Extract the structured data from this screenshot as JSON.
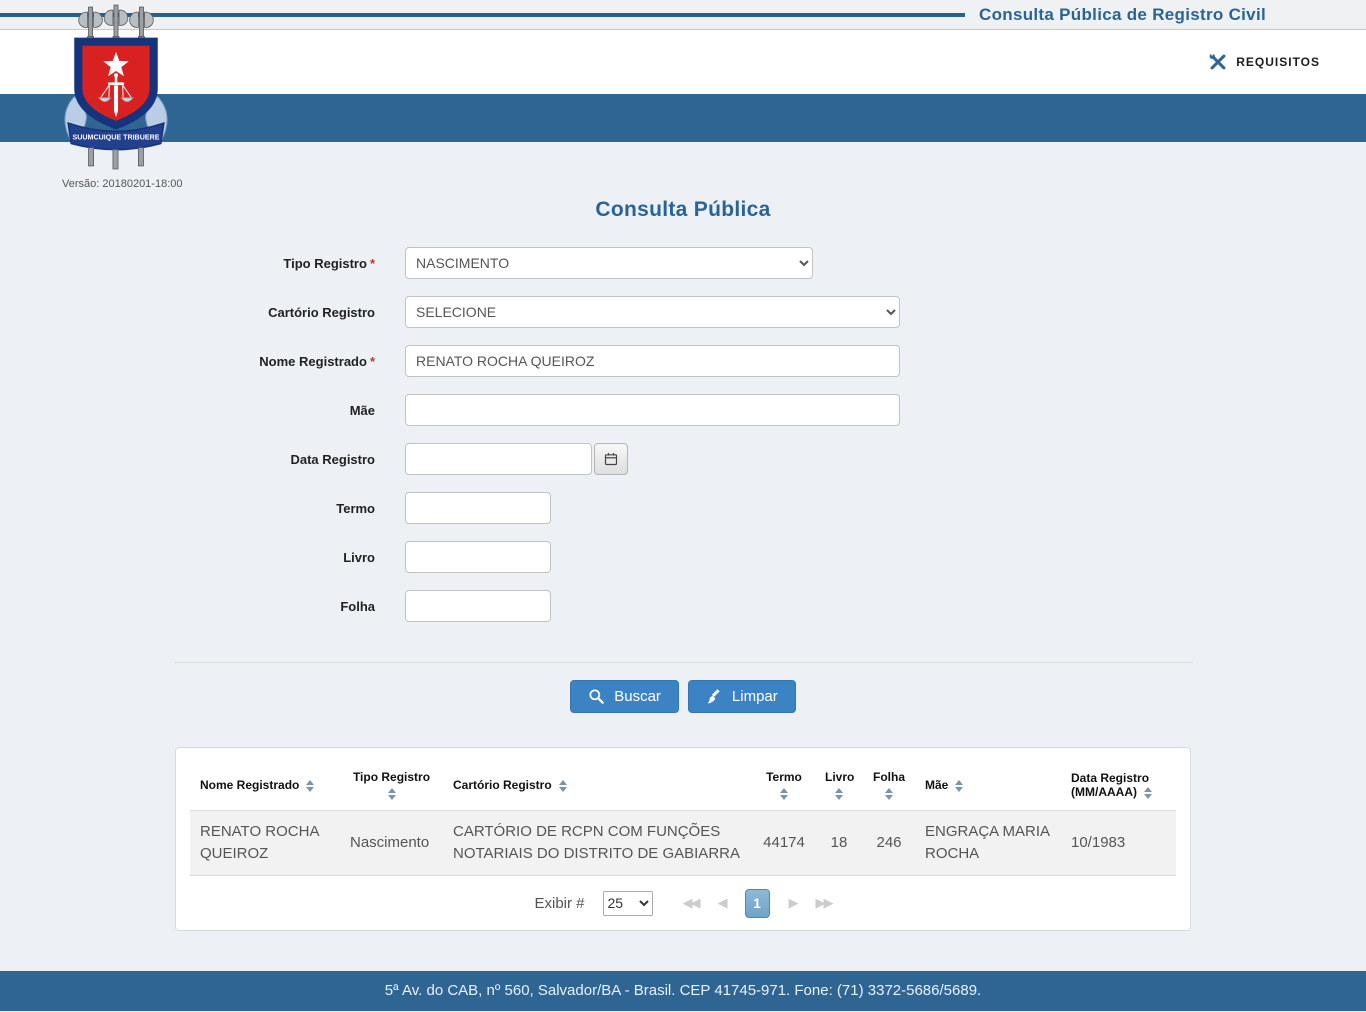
{
  "header": {
    "top_title": "Consulta Pública de Registro Civil",
    "requisitos_label": "REQUISITOS",
    "version": "Versão: 20180201-18:00",
    "logo_motto": "SUUMCUIQUE TRIBUERE"
  },
  "form": {
    "title": "Consulta Pública",
    "required_marker": "*",
    "tipo_registro": {
      "label": "Tipo Registro",
      "value": "NASCIMENTO"
    },
    "cartorio_registro": {
      "label": "Cartório Registro",
      "value": "SELECIONE"
    },
    "nome_registrado": {
      "label": "Nome Registrado",
      "value": "RENATO ROCHA QUEIROZ"
    },
    "mae": {
      "label": "Mãe",
      "value": ""
    },
    "data_registro": {
      "label": "Data Registro",
      "value": ""
    },
    "termo": {
      "label": "Termo",
      "value": ""
    },
    "livro": {
      "label": "Livro",
      "value": ""
    },
    "folha": {
      "label": "Folha",
      "value": ""
    },
    "buscar_label": "Buscar",
    "limpar_label": "Limpar"
  },
  "results": {
    "columns": {
      "nome": "Nome Registrado",
      "tipo": "Tipo Registro",
      "cartorio": "Cartório Registro",
      "termo": "Termo",
      "livro": "Livro",
      "folha": "Folha",
      "mae": "Mãe",
      "data_line1": "Data Registro",
      "data_line2": "(MM/AAAA)"
    },
    "rows": [
      {
        "nome": "RENATO ROCHA QUEIROZ",
        "tipo": "Nascimento",
        "cartorio": "CARTÓRIO DE RCPN COM FUNÇÕES NOTARIAIS DO DISTRITO DE GABIARRA",
        "termo": "44174",
        "livro": "18",
        "folha": "246",
        "mae": "ENGRAÇA MARIA ROCHA",
        "data": "10/1983"
      }
    ],
    "pagination": {
      "exibir_label": "Exibir #",
      "page_size": "25",
      "current_page": "1",
      "first_icon": "◀◀",
      "prev_icon": "◀",
      "next_icon": "▶",
      "last_icon": "▶▶"
    }
  },
  "footer": {
    "address": "5ª Av. do CAB, nº 560, Salvador/BA - Brasil. CEP 41745-971. Fone: (71) 3372-5686/5689."
  },
  "icons": {
    "requisitos": "crossed-tools",
    "buscar": "magnifier",
    "limpar": "broom",
    "data_registro": "calendar",
    "sort": "up-down-carets"
  },
  "colors": {
    "band_blue": "#2e6593",
    "title_blue": "#2a6496",
    "button_blue": "#3c83c4",
    "content_bg": "#edf1f6"
  }
}
